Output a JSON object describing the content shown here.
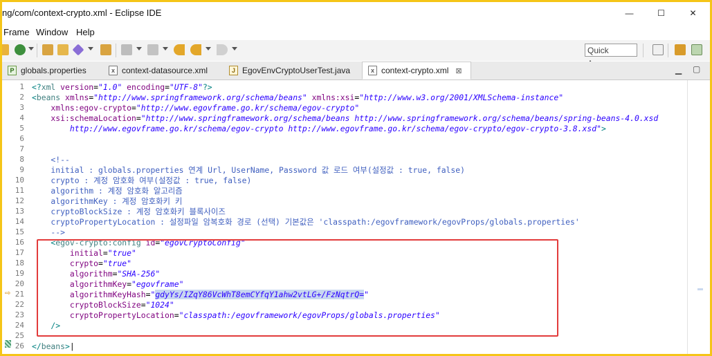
{
  "window": {
    "title": "ng/com/context-crypto.xml - Eclipse IDE",
    "controls": {
      "minimize": "—",
      "maximize": "☐",
      "close": "✕"
    }
  },
  "menu": [
    "Frame",
    "Window",
    "Help"
  ],
  "toolbar": {
    "quick_access": "Quick Access",
    "icons": [
      "new-icon",
      "run-icon",
      "open-folder-icon",
      "open-type-icon",
      "tools-icon",
      "search-icon",
      "nav-icon",
      "prev-edit-icon",
      "back-icon",
      "forward-icon",
      "open-perspective-icon",
      "perspective-java-icon",
      "perspective-egov-icon"
    ]
  },
  "tabs": [
    {
      "label": "globals.properties",
      "icon": "properties-file-icon",
      "active": false
    },
    {
      "label": "context-datasource.xml",
      "icon": "xml-file-icon",
      "active": false
    },
    {
      "label": "EgovEnvCryptoUserTest.java",
      "icon": "java-file-icon",
      "active": false
    },
    {
      "label": "context-crypto.xml",
      "icon": "xml-file-icon",
      "active": true,
      "close": "⊠"
    }
  ],
  "tab_controls": {
    "minimize": "▁",
    "maximize": "▢"
  },
  "editor": {
    "line_numbers": [
      "1",
      "2",
      "3",
      "4",
      "5",
      "6",
      "7",
      "8",
      "9",
      "10",
      "11",
      "12",
      "13",
      "14",
      "15",
      "16",
      "17",
      "18",
      "19",
      "20",
      "21",
      "22",
      "23",
      "24",
      "25",
      "26"
    ],
    "lines": [
      [
        {
          "t": "<?",
          "c": "bracket"
        },
        {
          "t": "xml ",
          "c": "tag"
        },
        {
          "t": "version",
          "c": "attr"
        },
        {
          "t": "=",
          "c": ""
        },
        {
          "t": "\"1.0\"",
          "c": "val"
        },
        {
          "t": " encoding",
          "c": "attr"
        },
        {
          "t": "=",
          "c": ""
        },
        {
          "t": "\"UTF-8\"",
          "c": "val"
        },
        {
          "t": "?>",
          "c": "bracket"
        }
      ],
      [
        {
          "t": "<",
          "c": "bracket"
        },
        {
          "t": "beans ",
          "c": "tag"
        },
        {
          "t": "xmlns",
          "c": "attr"
        },
        {
          "t": "=",
          "c": ""
        },
        {
          "t": "\"http://www.springframework.org/schema/beans\"",
          "c": "val"
        },
        {
          "t": " xmlns:xsi",
          "c": "attr"
        },
        {
          "t": "=",
          "c": ""
        },
        {
          "t": "\"http://www.w3.org/2001/XMLSchema-instance\"",
          "c": "val"
        }
      ],
      [
        {
          "t": "    xmlns:egov-crypto",
          "c": "attr"
        },
        {
          "t": "=",
          "c": ""
        },
        {
          "t": "\"http://www.egovframe.go.kr/schema/egov-crypto\"",
          "c": "val"
        }
      ],
      [
        {
          "t": "    xsi:schemaLocation",
          "c": "attr"
        },
        {
          "t": "=",
          "c": ""
        },
        {
          "t": "\"http://www.springframework.org/schema/beans http://www.springframework.org/schema/beans/spring-beans-4.0.xsd",
          "c": "val"
        }
      ],
      [
        {
          "t": "        http://www.egovframe.go.kr/schema/egov-crypto http://www.egovframe.go.kr/schema/egov-crypto/egov-crypto-3.8.xsd\"",
          "c": "val"
        },
        {
          "t": ">",
          "c": "bracket"
        }
      ],
      [],
      [],
      [
        {
          "t": "    <!--",
          "c": "cmt"
        }
      ],
      [
        {
          "t": "    initial : globals.properties 연계 Url, UserName, Password 값 로드 여부(설정값 : true, false)",
          "c": "cmt"
        }
      ],
      [
        {
          "t": "    crypto : 계정 암호화 여부(설정값 : true, false)",
          "c": "cmt"
        }
      ],
      [
        {
          "t": "    algorithm : 계정 암호화 알고리즘",
          "c": "cmt"
        }
      ],
      [
        {
          "t": "    algorithmKey : 계정 암호화키 키",
          "c": "cmt"
        }
      ],
      [
        {
          "t": "    cryptoBlockSize : 계정 암호화키 블록사이즈",
          "c": "cmt"
        }
      ],
      [
        {
          "t": "    cryptoPropertyLocation : 설정파일 암복호화 경로 (선택) 기본값은 'classpath:/egovframework/egovProps/globals.properties'",
          "c": "cmt"
        }
      ],
      [
        {
          "t": "    -->",
          "c": "cmt"
        }
      ],
      [
        {
          "t": "    <",
          "c": "bracket"
        },
        {
          "t": "egov-crypto:config ",
          "c": "tag"
        },
        {
          "t": "id",
          "c": "attr"
        },
        {
          "t": "=",
          "c": ""
        },
        {
          "t": "\"egovCryptoConfig\"",
          "c": "val"
        }
      ],
      [
        {
          "t": "        initial",
          "c": "attr"
        },
        {
          "t": "=",
          "c": ""
        },
        {
          "t": "\"true\"",
          "c": "val"
        }
      ],
      [
        {
          "t": "        crypto",
          "c": "attr"
        },
        {
          "t": "=",
          "c": ""
        },
        {
          "t": "\"true\"",
          "c": "val"
        }
      ],
      [
        {
          "t": "        algorithm",
          "c": "attr"
        },
        {
          "t": "=",
          "c": ""
        },
        {
          "t": "\"SHA-256\"",
          "c": "val"
        }
      ],
      [
        {
          "t": "        algorithmKey",
          "c": "attr"
        },
        {
          "t": "=",
          "c": ""
        },
        {
          "t": "\"egovframe\"",
          "c": "val"
        }
      ],
      [
        {
          "t": "        algorithmKeyHash",
          "c": "attr"
        },
        {
          "t": "=",
          "c": ""
        },
        {
          "t": "\"",
          "c": "val"
        },
        {
          "t": "gdyYs/IZqY86VcWhT8emCYfqY1ahw2vtLG+/FzNqtrQ=",
          "c": "val sel"
        },
        {
          "t": "\"",
          "c": "val"
        }
      ],
      [
        {
          "t": "        cryptoBlockSize",
          "c": "attr"
        },
        {
          "t": "=",
          "c": ""
        },
        {
          "t": "\"1024\"",
          "c": "val"
        }
      ],
      [
        {
          "t": "        cryptoPropertyLocation",
          "c": "attr"
        },
        {
          "t": "=",
          "c": ""
        },
        {
          "t": "\"classpath:/egovframework/egovProps/globals.properties\"",
          "c": "val"
        }
      ],
      [
        {
          "t": "    />",
          "c": "bracket"
        }
      ],
      [],
      [
        {
          "t": "</",
          "c": "bracket"
        },
        {
          "t": "beans",
          "c": "tag"
        },
        {
          "t": ">",
          "c": "bracket"
        },
        {
          "t": "|",
          "c": ""
        }
      ]
    ]
  }
}
